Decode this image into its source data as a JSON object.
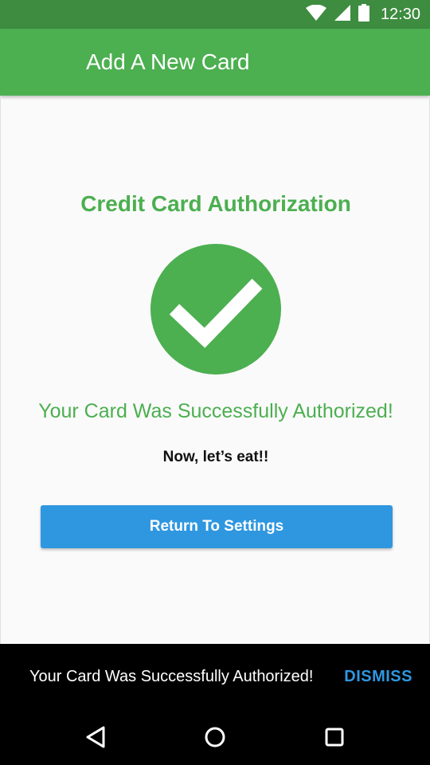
{
  "status_bar": {
    "time": "12:30",
    "icons": [
      "wifi-icon",
      "cell-signal-icon",
      "battery-icon"
    ]
  },
  "app_bar": {
    "title": "Add A New Card"
  },
  "main": {
    "heading": "Credit Card Authorization",
    "status_icon": "check-circle-icon",
    "success_message": "Your Card Was Successfully Authorized!",
    "sub_message": "Now, let’s eat!!",
    "return_button_label": "Return To Settings"
  },
  "snackbar": {
    "message": "Your Card Was Successfully Authorized!",
    "action_label": "DISMISS"
  },
  "nav_bar": {
    "buttons": [
      "back-icon",
      "home-icon",
      "recent-apps-icon"
    ]
  },
  "colors": {
    "status_bar": "#3d8c40",
    "primary": "#4caf50",
    "accent": "#2f97e0",
    "snackbar": "#000000"
  }
}
